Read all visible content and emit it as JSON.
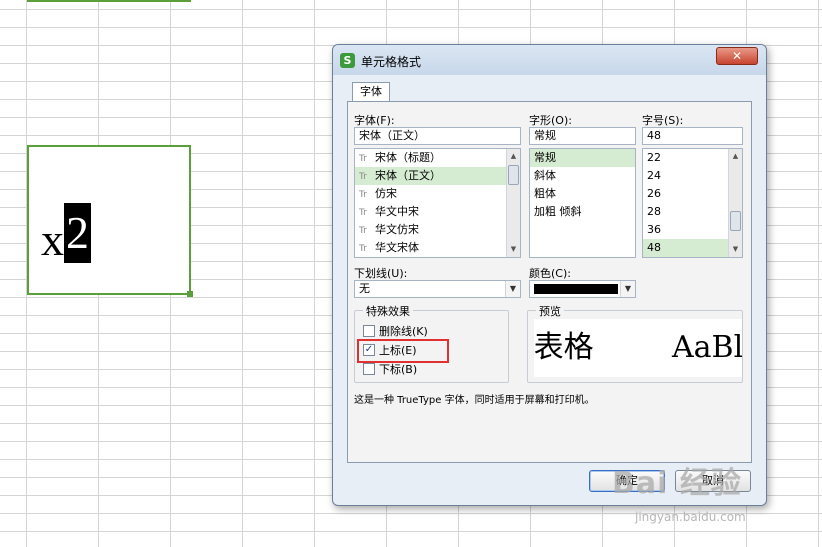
{
  "sheet": {
    "cell_base": "x",
    "cell_superscript": "2"
  },
  "dialog": {
    "title": "单元格格式",
    "app_icon": "S",
    "close_label": "✕",
    "tab_font": "字体",
    "font_label": "字体(F):",
    "font_value": "宋体（正文）",
    "font_list": [
      "宋体（标题）",
      "宋体（正文）",
      "仿宋",
      "华文中宋",
      "华文仿宋",
      "华文宋体"
    ],
    "font_selected_index": 1,
    "style_label": "字形(O):",
    "style_value": "常规",
    "style_list": [
      "常规",
      "斜体",
      "粗体",
      "加粗 倾斜"
    ],
    "style_selected_index": 0,
    "size_label": "字号(S):",
    "size_value": "48",
    "size_list": [
      "22",
      "24",
      "26",
      "28",
      "36",
      "48"
    ],
    "size_selected_index": 5,
    "underline_label": "下划线(U):",
    "underline_value": "无",
    "color_label": "颜色(C):",
    "color_value": "#000000",
    "effects_title": "特殊效果",
    "effects": [
      {
        "label": "删除线(K)",
        "checked": false
      },
      {
        "label": "上标(E)",
        "checked": true
      },
      {
        "label": "下标(B)",
        "checked": false
      }
    ],
    "preview_title": "预览",
    "preview_text_a": "i表格",
    "preview_text_b": "AaBl",
    "info_text": "这是一种 TrueType 字体，同时适用于屏幕和打印机。",
    "ok_label": "确定",
    "cancel_label": "取消",
    "highlight_color": "#e03030"
  },
  "watermark": {
    "main": "Bai 经验",
    "sub": "jingyan.baidu.com"
  }
}
